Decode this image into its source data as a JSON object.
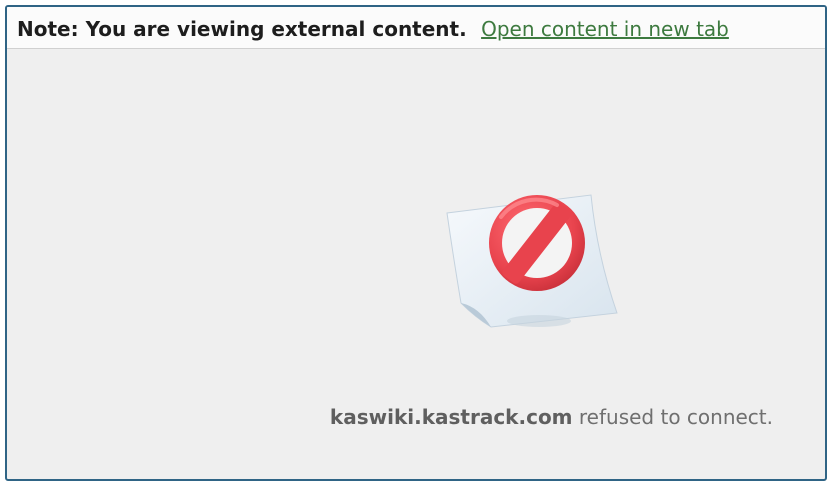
{
  "note_bar": {
    "message": "Note: You are viewing external content.",
    "link_label": "Open content in new tab"
  },
  "error": {
    "icon": "blocked-page-icon",
    "host": "kaswiki.kastrack.com",
    "message": "refused to connect."
  },
  "colors": {
    "frame_border": "#2f6485",
    "link": "#3d7a3f",
    "background": "#efefef",
    "error_icon": "#e8434d"
  }
}
